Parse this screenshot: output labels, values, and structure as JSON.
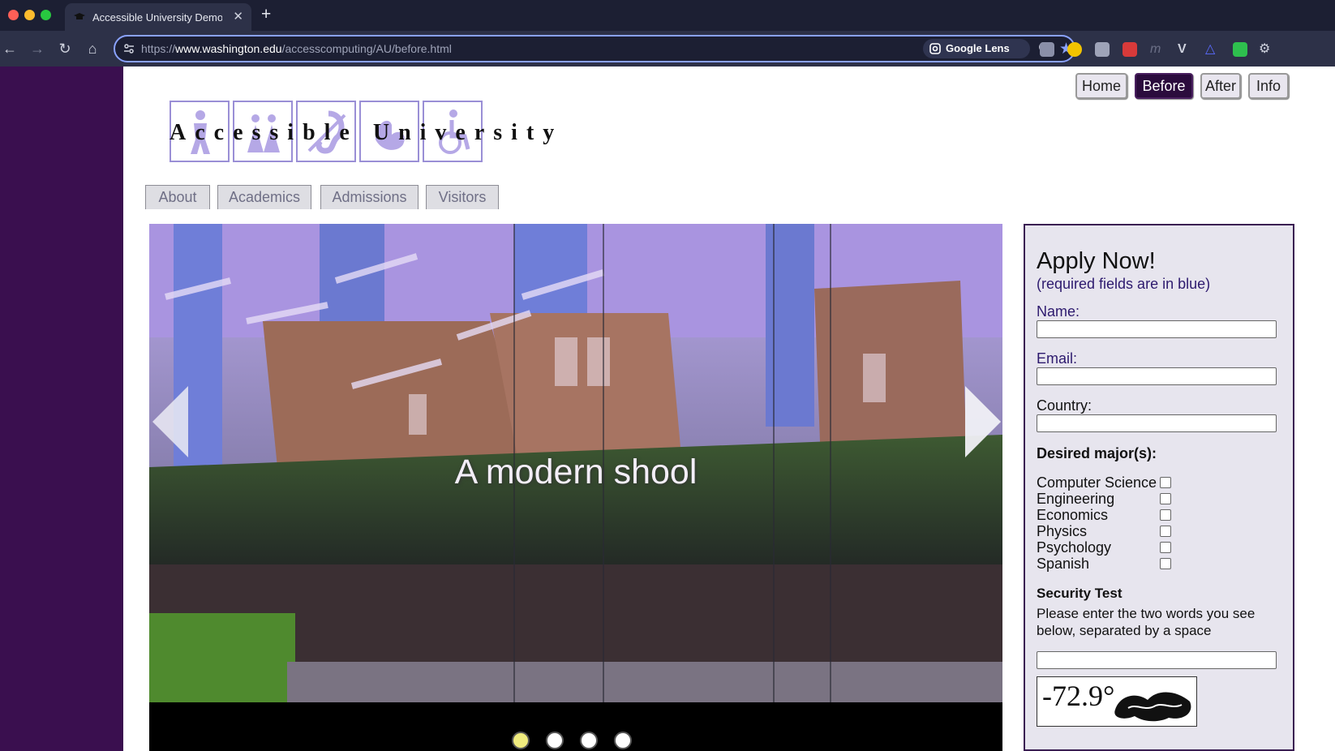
{
  "browser": {
    "tab_title": "Accessible University Demo S",
    "new_tab": "+",
    "tab_close": "✕",
    "url_scheme": "https://",
    "url_host": "www.washington.edu",
    "url_path": "/accesscomputing/AU/before.html",
    "lens_label": "Google Lens",
    "accent_color": "#8aa2ff"
  },
  "top_nav": {
    "home": "Home",
    "before": "Before",
    "after": "After",
    "info": "Info",
    "active": "Before"
  },
  "logo": {
    "text": "Accessible University"
  },
  "main_nav": {
    "about": "About",
    "academics": "Academics",
    "admissions": "Admissions",
    "visitors": "Visitors"
  },
  "carousel": {
    "caption": "A modern shool",
    "active_slide": 1,
    "slide_count": 4
  },
  "apply": {
    "title": "Apply Now!",
    "note": "(required fields are in blue)",
    "name_label": "Name:",
    "email_label": "Email:",
    "country_label": "Country:",
    "majors_label": "Desired major(s):",
    "majors": [
      "Computer Science",
      "Engineering",
      "Economics",
      "Physics",
      "Psychology",
      "Spanish"
    ],
    "security_label": "Security Test",
    "security_text": "Please enter the two words you see below, separated by a space",
    "captcha_text": "-72.9°"
  }
}
